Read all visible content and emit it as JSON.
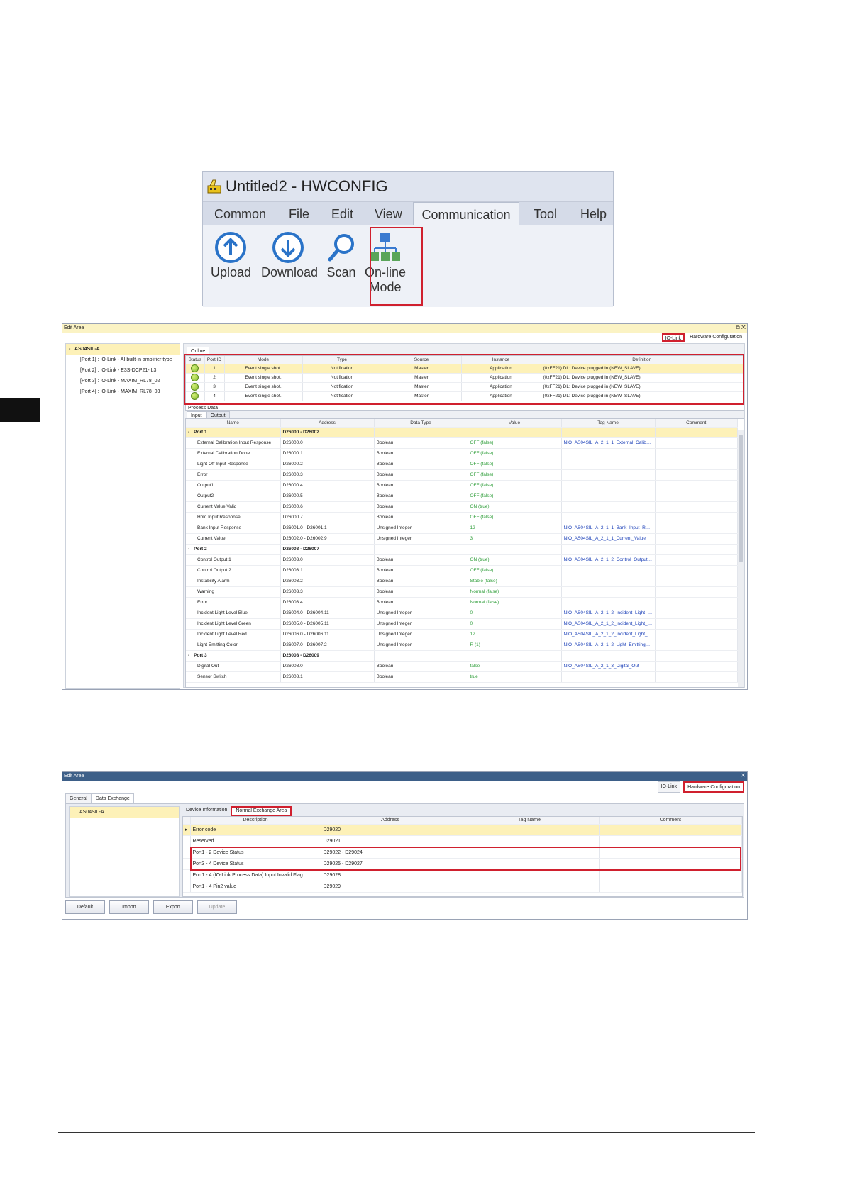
{
  "ribbon": {
    "app_title": "Untitled2 - HWCONFIG",
    "menu": [
      "Common",
      "File",
      "Edit",
      "View",
      "Communication",
      "Tool",
      "Help"
    ],
    "tools": {
      "upload": "Upload",
      "download": "Download",
      "scan": "Scan",
      "online_line1": "On-line",
      "online_line2": "Mode"
    }
  },
  "w1": {
    "title": "Edit Area",
    "tabs": {
      "iolink": "IO-Link",
      "hwconfig": "Hardware Configuration"
    },
    "tree": {
      "root": "AS04SIL-A",
      "ports": [
        "[Port 1] : IO-Link - AI built-in amplifier type",
        "[Port 2] : IO-Link - E3S-DCP21-IL3",
        "[Port 3] : IO-Link - MAXIM_RL78_02",
        "[Port 4] : IO-Link - MAXIM_RL78_03"
      ]
    },
    "online_tab": "Online",
    "event_headers": [
      "Status",
      "Port ID",
      "Mode",
      "Type",
      "Source",
      "Instance",
      "Definition"
    ],
    "events": [
      {
        "port": "1",
        "mode": "Event single shot.",
        "type": "Notification",
        "source": "Master",
        "instance": "Application",
        "definition": "(0xFF21) DL: Device plugged in (NEW_SLAVE)."
      },
      {
        "port": "2",
        "mode": "Event single shot.",
        "type": "Notification",
        "source": "Master",
        "instance": "Application",
        "definition": "(0xFF21) DL: Device plugged in (NEW_SLAVE)."
      },
      {
        "port": "3",
        "mode": "Event single shot.",
        "type": "Notification",
        "source": "Master",
        "instance": "Application",
        "definition": "(0xFF21) DL: Device plugged in (NEW_SLAVE)."
      },
      {
        "port": "4",
        "mode": "Event single shot.",
        "type": "Notification",
        "source": "Master",
        "instance": "Application",
        "definition": "(0xFF21) DL: Device plugged in (NEW_SLAVE)."
      }
    ],
    "process_label": "Process Data",
    "pd_tabs": [
      "Input",
      "Output"
    ],
    "pd_headers": [
      "Name",
      "Address",
      "Data Type",
      "Value",
      "Tag Name",
      "Comment"
    ],
    "pd_rows": [
      {
        "group": true,
        "name": "Port 1",
        "address": "D26000 - D26002"
      },
      {
        "name": "External Calibration Input Response",
        "address": "D26000.0",
        "type": "Boolean",
        "value": "OFF (false)",
        "tag": "NIO_AS04SIL_A_2_1_1_External_Calibration"
      },
      {
        "name": "External Calibration Done",
        "address": "D26000.1",
        "type": "Boolean",
        "value": "OFF (false)",
        "tag": ""
      },
      {
        "name": "Light Off Input Response",
        "address": "D26000.2",
        "type": "Boolean",
        "value": "OFF (false)",
        "tag": ""
      },
      {
        "name": "Error",
        "address": "D26000.3",
        "type": "Boolean",
        "value": "OFF (false)",
        "tag": ""
      },
      {
        "name": "Output1",
        "address": "D26000.4",
        "type": "Boolean",
        "value": "OFF (false)",
        "tag": ""
      },
      {
        "name": "Output2",
        "address": "D26000.5",
        "type": "Boolean",
        "value": "OFF (false)",
        "tag": ""
      },
      {
        "name": "Current Value Valid",
        "address": "D26000.6",
        "type": "Boolean",
        "value": "ON (true)",
        "tag": ""
      },
      {
        "name": "Hold Input Response",
        "address": "D26000.7",
        "type": "Boolean",
        "value": "OFF (false)",
        "tag": ""
      },
      {
        "name": "Bank Input Response",
        "address": "D26001.0 - D26001.1",
        "type": "Unsigned Integer",
        "value": "12",
        "tag": "NIO_AS04SIL_A_2_1_1_Bank_Input_Resp..."
      },
      {
        "name": "Current Value",
        "address": "D26002.0 - D26002.9",
        "type": "Unsigned Integer",
        "value": "3",
        "tag": "NIO_AS04SIL_A_2_1_1_Current_Value"
      },
      {
        "group": true,
        "name": "Port 2",
        "address": "D26003 - D26007"
      },
      {
        "name": "Control Output 1",
        "address": "D26003.0",
        "type": "Boolean",
        "value": "ON (true)",
        "tag": "NIO_AS04SIL_A_2_1_2_Control_Output_1"
      },
      {
        "name": "Control Output 2",
        "address": "D26003.1",
        "type": "Boolean",
        "value": "OFF (false)",
        "tag": ""
      },
      {
        "name": "Instability Alarm",
        "address": "D26003.2",
        "type": "Boolean",
        "value": "Stable (false)",
        "tag": ""
      },
      {
        "name": "Warning",
        "address": "D26003.3",
        "type": "Boolean",
        "value": "Normal (false)",
        "tag": ""
      },
      {
        "name": "Error",
        "address": "D26003.4",
        "type": "Boolean",
        "value": "Normal (false)",
        "tag": ""
      },
      {
        "name": "Incident Light Level Blue",
        "address": "D26004.0 - D26004.11",
        "type": "Unsigned Integer",
        "value": "0",
        "tag": "NIO_AS04SIL_A_2_1_2_Incident_Light_L..."
      },
      {
        "name": "Incident Light Level Green",
        "address": "D26005.0 - D26005.11",
        "type": "Unsigned Integer",
        "value": "0",
        "tag": "NIO_AS04SIL_A_2_1_2_Incident_Light_L..."
      },
      {
        "name": "Incident Light Level Red",
        "address": "D26006.0 - D26006.11",
        "type": "Unsigned Integer",
        "value": "12",
        "tag": "NIO_AS04SIL_A_2_1_2_Incident_Light_L..."
      },
      {
        "name": "Light Emitting Color",
        "address": "D26007.0 - D26007.2",
        "type": "Unsigned Integer",
        "value": "R (1)",
        "tag": "NIO_AS04SIL_A_2_1_2_Light_Emitting_C..."
      },
      {
        "group": true,
        "name": "Port 3",
        "address": "D26008 - D26009"
      },
      {
        "name": "Digital Out",
        "address": "D26008.0",
        "type": "Boolean",
        "value": "false",
        "tag": "NIO_AS04SIL_A_2_1_3_Digital_Out"
      },
      {
        "name": "Sensor Switch",
        "address": "D26008.1",
        "type": "Boolean",
        "value": "true",
        "tag": ""
      }
    ]
  },
  "w2": {
    "title": "Edit Area",
    "tabs": {
      "iolink": "IO-Link",
      "hwconfig": "Hardware Configuration"
    },
    "left_tabs": [
      "General",
      "Data Exchange"
    ],
    "tree_root": "AS04SIL-A",
    "inner_tabs": [
      "Device Information",
      "Normal Exchange Area"
    ],
    "headers": [
      "Description",
      "Address",
      "Tag Name",
      "Comment"
    ],
    "rows": [
      {
        "desc": "Error code",
        "address": "D29020"
      },
      {
        "desc": "Reserved",
        "address": "D29021"
      },
      {
        "desc": "Port1 - 2 Device Status",
        "address": "D29022 - D29024"
      },
      {
        "desc": "Port3 - 4 Device Status",
        "address": "D29025 - D29027"
      },
      {
        "desc": "Port1 - 4 (IO-Link Process Data) Input Invalid Flag",
        "address": "D29028"
      },
      {
        "desc": "Port1 - 4 Pin2 value",
        "address": "D29029"
      }
    ],
    "buttons": [
      "Default",
      "Import",
      "Export",
      "Update"
    ]
  }
}
